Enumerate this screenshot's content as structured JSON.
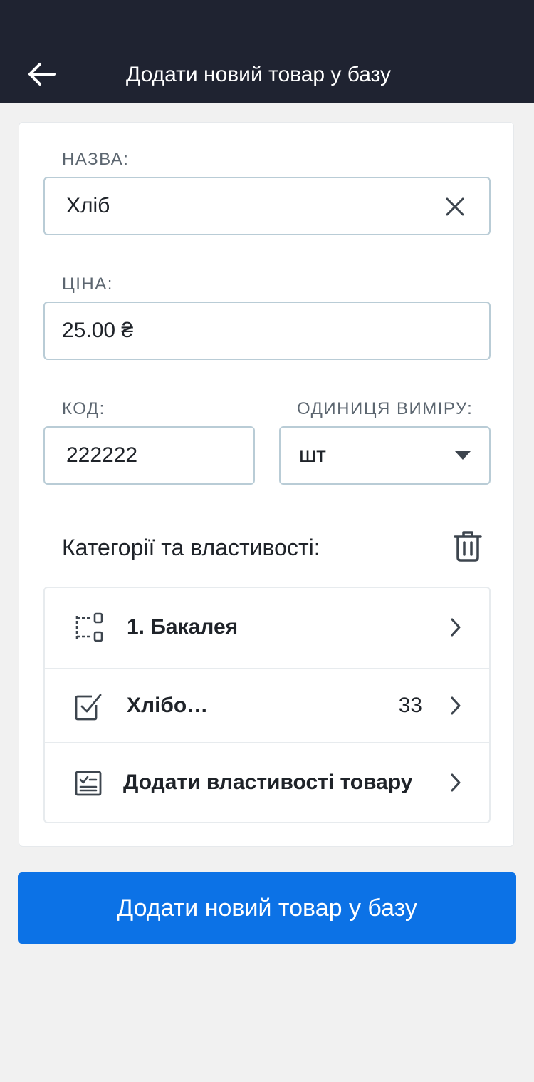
{
  "header": {
    "title": "Додати новий товар у базу",
    "back_icon": "arrow-left-icon"
  },
  "form": {
    "name": {
      "label": "НАЗВА:",
      "value": "Хліб"
    },
    "price": {
      "label": "ЦІНА:",
      "value": "25.00 ₴"
    },
    "code": {
      "label": "КОД:",
      "value": "222222"
    },
    "unit": {
      "label": "ОДИНИЦЯ ВИМІРУ:",
      "value": "шт"
    }
  },
  "categories": {
    "title": "Категорії та властивості:",
    "items": [
      {
        "label": "1. Бакалея",
        "count": "",
        "icon": "category-tree-icon"
      },
      {
        "label": "Хлібо…",
        "count": "33",
        "icon": "checkbox-icon"
      },
      {
        "label": "Додати властивості товару",
        "count": "",
        "icon": "properties-list-icon"
      }
    ]
  },
  "actions": {
    "submit_label": "Додати новий товар у базу"
  },
  "colors": {
    "header_bg": "#1f2331",
    "primary": "#0c72e6",
    "input_border": "#b9ccd6"
  }
}
